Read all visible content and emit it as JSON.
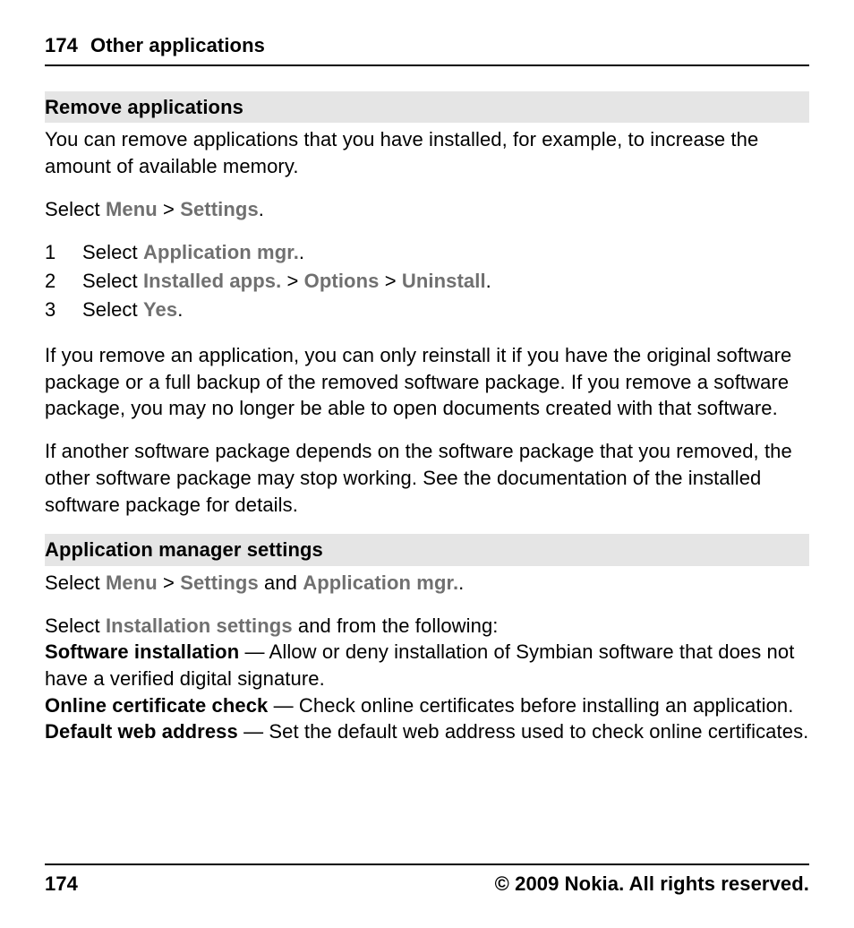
{
  "header": {
    "page_number": "174",
    "chapter_title": "Other applications"
  },
  "sections": {
    "remove": {
      "heading": "Remove applications",
      "intro": "You can remove applications that you have installed, for example, to increase the amount of available memory.",
      "select_prefix": "Select ",
      "menu": "Menu",
      "gt1": " > ",
      "settings": "Settings",
      "period": ".",
      "steps": [
        {
          "n": "1",
          "pre": "Select ",
          "b1": "Application mgr.",
          "post": "."
        },
        {
          "n": "2",
          "pre": "Select ",
          "b1": "Installed apps.",
          "g1": " > ",
          "b2": "Options",
          "g2": " > ",
          "b3": "Uninstall",
          "post": "."
        },
        {
          "n": "3",
          "pre": "Select ",
          "b1": "Yes",
          "post": "."
        }
      ],
      "para1": "If you remove an application, you can only reinstall it if you have the original software package or a full backup of the removed software package. If you remove a software package, you may no longer be able to open documents created with that software.",
      "para2": "If another software package depends on the software package that you removed, the other software package may stop working. See the documentation of the installed software package for details."
    },
    "appmgr": {
      "heading": "Application manager settings",
      "line1_pre": "Select ",
      "line1_menu": "Menu",
      "line1_gt": " > ",
      "line1_settings": "Settings",
      "line1_and": " and ",
      "line1_appmgr": "Application mgr.",
      "line1_post": ".",
      "line2_pre": "Select ",
      "line2_inst": "Installation settings",
      "line2_post": " and from the following:",
      "items": [
        {
          "term": "Software installation",
          "desc": " — Allow or deny installation of Symbian software that does not have a verified digital signature."
        },
        {
          "term": "Online certificate check",
          "desc": " — Check online certificates before installing an application."
        },
        {
          "term": "Default web address",
          "desc": " — Set the default web address used to check online certificates."
        }
      ]
    }
  },
  "footer": {
    "page_number": "174",
    "copyright": "© 2009 Nokia. All rights reserved."
  }
}
